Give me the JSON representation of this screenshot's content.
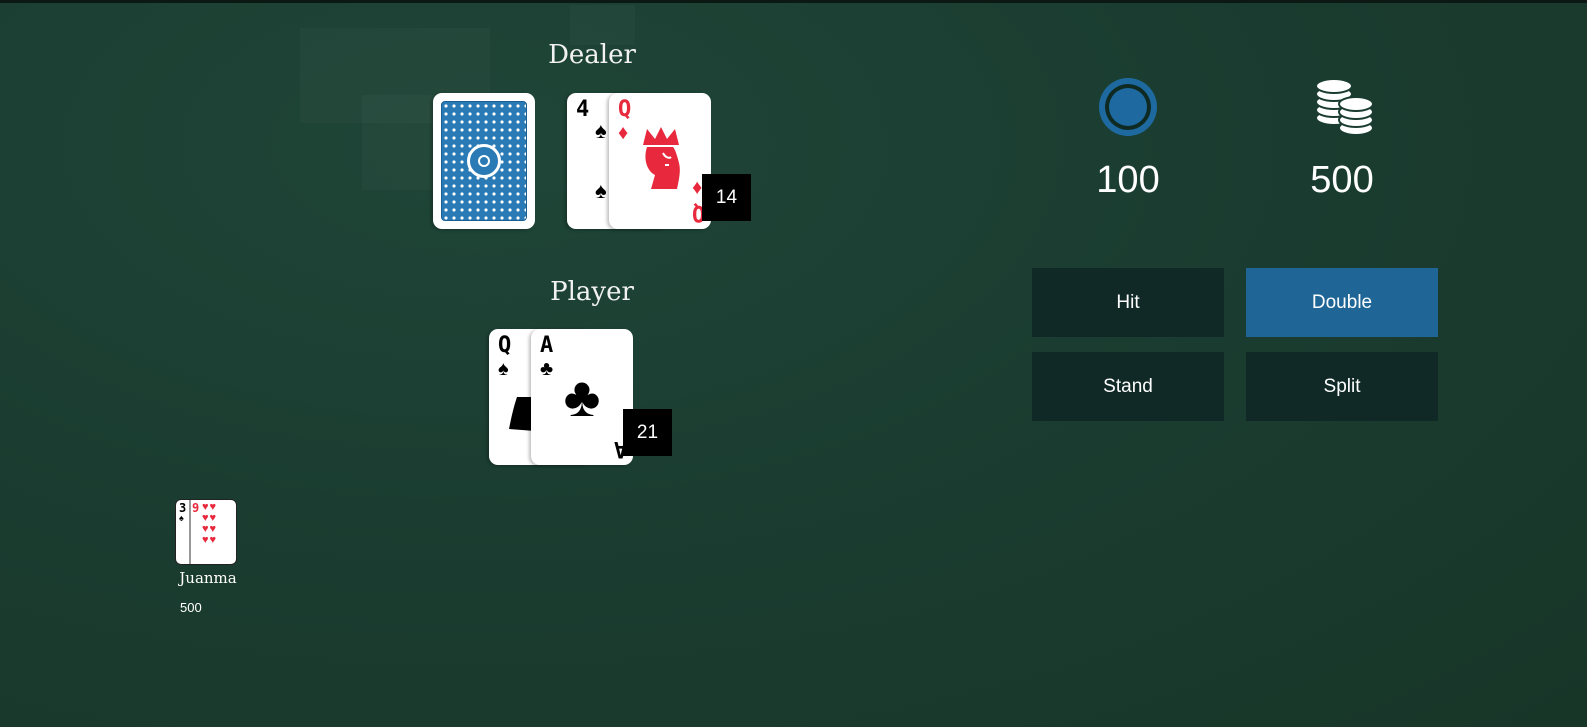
{
  "dealer": {
    "title": "Dealer",
    "cards": [
      {
        "face": "back"
      },
      {
        "rank": "4",
        "suit": "♠",
        "color": "black"
      },
      {
        "rank": "Q",
        "suit": "♦",
        "color": "red"
      }
    ],
    "score": "14"
  },
  "player": {
    "title": "Player",
    "cards": [
      {
        "rank": "Q",
        "suit": "♠",
        "color": "black"
      },
      {
        "rank": "A",
        "suit": "♣",
        "color": "black"
      }
    ],
    "score": "21"
  },
  "stats": {
    "bet": {
      "icon": "chip-icon",
      "value": "100"
    },
    "balance": {
      "icon": "coins-icon",
      "value": "500"
    }
  },
  "actions": {
    "hit": "Hit",
    "double": "Double",
    "stand": "Stand",
    "split": "Split"
  },
  "seats": [
    {
      "name": "Juanma",
      "balance": "500",
      "cards": [
        {
          "rank": "3",
          "suit": "♠"
        },
        {
          "rank": "9",
          "suit": "♥"
        }
      ]
    }
  ],
  "colors": {
    "table": "#1b3d31",
    "button": "#102926",
    "primary_button": "#1f6596",
    "red_suit": "#e8283c"
  }
}
